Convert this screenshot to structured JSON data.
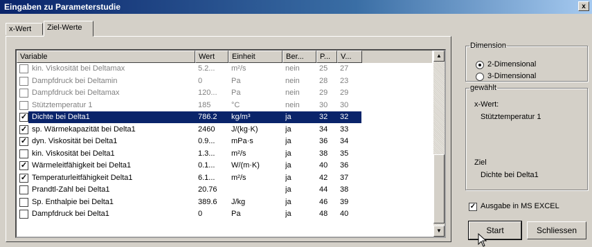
{
  "window": {
    "title": "Eingaben zu Parameterstudie",
    "close_label": "x"
  },
  "tabs": [
    {
      "label": "x-Wert"
    },
    {
      "label": "Ziel-Werte"
    }
  ],
  "table": {
    "headers": [
      "Variable",
      "Wert",
      "Einheit",
      "Ber...",
      "P...",
      "V..."
    ],
    "rows": [
      {
        "checked": false,
        "enabled": false,
        "selected": false,
        "variable": "kin. Viskosität bei Deltamax",
        "wert": "5.2...",
        "einheit": "m²/s",
        "ber": "nein",
        "p": "25",
        "v": "27"
      },
      {
        "checked": false,
        "enabled": false,
        "selected": false,
        "variable": "Dampfdruck bei Deltamin",
        "wert": "0",
        "einheit": "Pa",
        "ber": "nein",
        "p": "28",
        "v": "23"
      },
      {
        "checked": false,
        "enabled": false,
        "selected": false,
        "variable": "Dampfdruck bei Deltamax",
        "wert": "120...",
        "einheit": "Pa",
        "ber": "nein",
        "p": "29",
        "v": "29"
      },
      {
        "checked": false,
        "enabled": false,
        "selected": false,
        "variable": "Stütztemperatur 1",
        "wert": "185",
        "einheit": "°C",
        "ber": "nein",
        "p": "30",
        "v": "30"
      },
      {
        "checked": true,
        "enabled": true,
        "selected": true,
        "variable": "Dichte bei Delta1",
        "wert": "786.2",
        "einheit": "kg/m³",
        "ber": "ja",
        "p": "32",
        "v": "32"
      },
      {
        "checked": true,
        "enabled": true,
        "selected": false,
        "variable": "sp. Wärmekapazität bei Delta1",
        "wert": "2460",
        "einheit": "J/(kg·K)",
        "ber": "ja",
        "p": "34",
        "v": "33"
      },
      {
        "checked": true,
        "enabled": true,
        "selected": false,
        "variable": "dyn. Viskosität bei Delta1",
        "wert": "0.9...",
        "einheit": "mPa·s",
        "ber": "ja",
        "p": "36",
        "v": "34"
      },
      {
        "checked": false,
        "enabled": true,
        "selected": false,
        "variable": "kin. Viskosität bei Delta1",
        "wert": "1.3...",
        "einheit": "m²/s",
        "ber": "ja",
        "p": "38",
        "v": "35"
      },
      {
        "checked": true,
        "enabled": true,
        "selected": false,
        "variable": "Wärmeleitfähigkeit bei Delta1",
        "wert": "0.1...",
        "einheit": "W/(m·K)",
        "ber": "ja",
        "p": "40",
        "v": "36"
      },
      {
        "checked": true,
        "enabled": true,
        "selected": false,
        "variable": "Temperaturleitfähigkeit Delta1",
        "wert": "6.1...",
        "einheit": "m²/s",
        "ber": "ja",
        "p": "42",
        "v": "37"
      },
      {
        "checked": false,
        "enabled": true,
        "selected": false,
        "variable": "Prandtl-Zahl bei Delta1",
        "wert": "20.76",
        "einheit": "",
        "ber": "ja",
        "p": "44",
        "v": "38"
      },
      {
        "checked": false,
        "enabled": true,
        "selected": false,
        "variable": "Sp. Enthalpie bei Delta1",
        "wert": "389.6",
        "einheit": "J/kg",
        "ber": "ja",
        "p": "46",
        "v": "39"
      },
      {
        "checked": false,
        "enabled": true,
        "selected": false,
        "variable": "Dampfdruck bei Delta1",
        "wert": "0",
        "einheit": "Pa",
        "ber": "ja",
        "p": "48",
        "v": "40"
      }
    ]
  },
  "dimension": {
    "legend": "Dimension",
    "options": [
      {
        "label": "2-Dimensional",
        "selected": true
      },
      {
        "label": "3-Dimensional",
        "selected": false
      }
    ]
  },
  "selection": {
    "legend": "gewählt",
    "xwert_label": "x-Wert:",
    "xwert_value": "Stütztemperatur 1",
    "ziel_label": "Ziel",
    "ziel_value": "Dichte bei Delta1"
  },
  "excel_checkbox": {
    "label": "Ausgabe in MS EXCEL",
    "checked": true
  },
  "buttons": {
    "start": "Start",
    "close": "Schliessen"
  }
}
